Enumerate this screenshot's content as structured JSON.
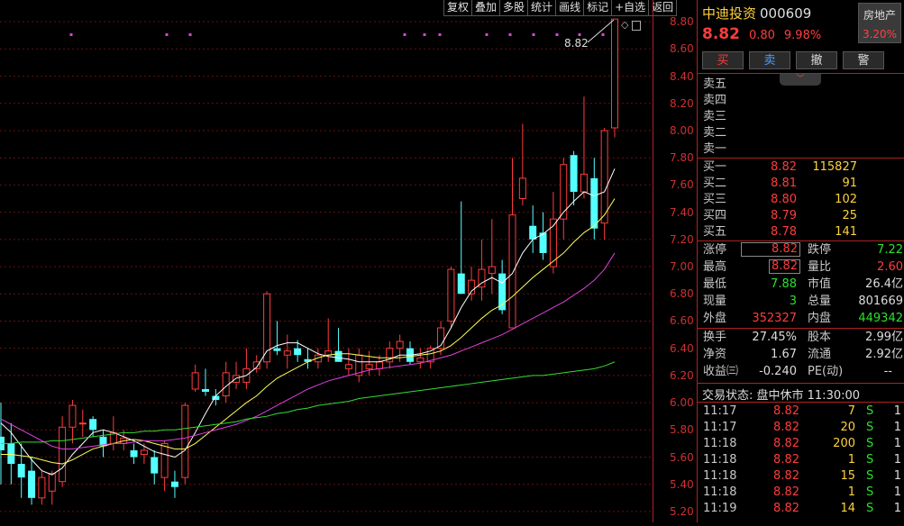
{
  "toolbar": [
    "复权",
    "叠加",
    "多股",
    "统计",
    "画线",
    "标记",
    "+自选",
    "返回"
  ],
  "chart_data": {
    "type": "candlestick",
    "y_axis_ticks": [
      "8.80",
      "8.60",
      "8.40",
      "8.20",
      "8.00",
      "7.80",
      "7.60",
      "7.40",
      "7.20",
      "7.00",
      "6.80",
      "6.60",
      "6.40",
      "6.20",
      "6.00",
      "5.80",
      "5.60",
      "5.40",
      "5.20"
    ],
    "ylim": [
      5.12,
      8.96
    ],
    "last_price_label": "8.82",
    "candles": [
      [
        5.75,
        6.0,
        5.4,
        5.65
      ],
      [
        5.7,
        5.85,
        5.4,
        5.55
      ],
      [
        5.55,
        5.7,
        5.3,
        5.45
      ],
      [
        5.5,
        5.6,
        5.25,
        5.3
      ],
      [
        5.3,
        5.5,
        5.25,
        5.45
      ],
      [
        5.35,
        5.5,
        5.25,
        5.48
      ],
      [
        5.42,
        5.9,
        5.38,
        5.82
      ],
      [
        5.82,
        6.02,
        5.7,
        5.98
      ],
      [
        5.85,
        5.95,
        5.75,
        5.85
      ],
      [
        5.88,
        5.9,
        5.75,
        5.8
      ],
      [
        5.75,
        5.8,
        5.6,
        5.68
      ],
      [
        5.7,
        5.9,
        5.65,
        5.78
      ],
      [
        5.7,
        5.8,
        5.65,
        5.74
      ],
      [
        5.65,
        5.7,
        5.55,
        5.6
      ],
      [
        5.62,
        5.7,
        5.55,
        5.65
      ],
      [
        5.6,
        5.65,
        5.4,
        5.48
      ],
      [
        5.45,
        5.72,
        5.35,
        5.7
      ],
      [
        5.42,
        5.5,
        5.3,
        5.38
      ],
      [
        5.45,
        6.0,
        5.4,
        5.98
      ],
      [
        6.1,
        6.28,
        6.08,
        6.22
      ],
      [
        6.1,
        6.25,
        6.05,
        6.08
      ],
      [
        6.05,
        6.1,
        5.98,
        6.02
      ],
      [
        6.05,
        6.3,
        6.0,
        6.22
      ],
      [
        6.15,
        6.3,
        6.1,
        6.2
      ],
      [
        6.15,
        6.4,
        6.1,
        6.25
      ],
      [
        6.25,
        6.35,
        6.22,
        6.3
      ],
      [
        6.3,
        6.82,
        6.25,
        6.8
      ],
      [
        6.4,
        6.6,
        6.35,
        6.38
      ],
      [
        6.35,
        6.5,
        6.25,
        6.38
      ],
      [
        6.4,
        6.46,
        6.3,
        6.35
      ],
      [
        6.32,
        6.4,
        6.25,
        6.3
      ],
      [
        6.3,
        6.4,
        6.25,
        6.35
      ],
      [
        6.35,
        6.62,
        6.3,
        6.38
      ],
      [
        6.38,
        6.55,
        6.35,
        6.3
      ],
      [
        6.25,
        6.4,
        6.2,
        6.28
      ],
      [
        6.2,
        6.4,
        6.15,
        6.35
      ],
      [
        6.25,
        6.38,
        6.2,
        6.28
      ],
      [
        6.25,
        6.35,
        6.2,
        6.3
      ],
      [
        6.3,
        6.45,
        6.25,
        6.4
      ],
      [
        6.4,
        6.5,
        6.3,
        6.45
      ],
      [
        6.4,
        6.45,
        6.28,
        6.3
      ],
      [
        6.3,
        6.4,
        6.25,
        6.33
      ],
      [
        6.3,
        6.42,
        6.25,
        6.4
      ],
      [
        6.4,
        6.6,
        6.35,
        6.55
      ],
      [
        6.6,
        7.0,
        6.55,
        6.98
      ],
      [
        6.95,
        7.48,
        6.8,
        6.8
      ],
      [
        6.8,
        7.0,
        6.75,
        6.9
      ],
      [
        6.85,
        7.2,
        6.75,
        6.98
      ],
      [
        6.95,
        7.35,
        6.8,
        7.0
      ],
      [
        6.95,
        7.05,
        6.65,
        6.68
      ],
      [
        6.55,
        7.8,
        6.55,
        7.38
      ],
      [
        7.5,
        8.05,
        7.45,
        7.65
      ],
      [
        7.3,
        7.45,
        7.1,
        7.2
      ],
      [
        7.25,
        7.4,
        7.05,
        7.1
      ],
      [
        7.0,
        7.55,
        6.95,
        7.35
      ],
      [
        7.35,
        7.8,
        7.2,
        7.75
      ],
      [
        7.82,
        7.85,
        7.45,
        7.55
      ],
      [
        7.55,
        8.25,
        7.5,
        7.68
      ],
      [
        7.65,
        7.8,
        7.2,
        7.28
      ],
      [
        7.32,
        8.02,
        7.2,
        8.0
      ],
      [
        8.02,
        8.82,
        7.95,
        8.82
      ]
    ],
    "ma_series": [
      {
        "color": "#ffffff",
        "values": [
          5.85,
          5.78,
          5.68,
          5.58,
          5.5,
          5.47,
          5.52,
          5.62,
          5.7,
          5.78,
          5.8,
          5.78,
          5.75,
          5.72,
          5.68,
          5.64,
          5.62,
          5.6,
          5.65,
          5.78,
          5.92,
          6.05,
          6.12,
          6.18,
          6.2,
          6.26,
          6.38,
          6.42,
          6.44,
          6.44,
          6.4,
          6.36,
          6.34,
          6.33,
          6.32,
          6.3,
          6.3,
          6.3,
          6.32,
          6.35,
          6.35,
          6.36,
          6.38,
          6.42,
          6.55,
          6.7,
          6.82,
          6.88,
          6.92,
          6.88,
          6.95,
          7.1,
          7.2,
          7.24,
          7.3,
          7.4,
          7.48,
          7.55,
          7.52,
          7.55,
          7.72
        ]
      },
      {
        "color": "#ffff55",
        "values": [
          5.62,
          5.62,
          5.61,
          5.6,
          5.58,
          5.56,
          5.55,
          5.58,
          5.62,
          5.66,
          5.68,
          5.7,
          5.72,
          5.73,
          5.72,
          5.7,
          5.68,
          5.66,
          5.66,
          5.7,
          5.76,
          5.82,
          5.88,
          5.94,
          6.0,
          6.05,
          6.12,
          6.18,
          6.22,
          6.26,
          6.3,
          6.33,
          6.35,
          6.36,
          6.36,
          6.35,
          6.34,
          6.33,
          6.33,
          6.33,
          6.34,
          6.35,
          6.36,
          6.38,
          6.42,
          6.48,
          6.55,
          6.62,
          6.68,
          6.72,
          6.78,
          6.85,
          6.92,
          6.98,
          7.04,
          7.1,
          7.18,
          7.25,
          7.3,
          7.38,
          7.5
        ]
      },
      {
        "color": "#e040e0",
        "values": [
          5.88,
          5.84,
          5.8,
          5.76,
          5.72,
          5.68,
          5.66,
          5.66,
          5.67,
          5.68,
          5.69,
          5.7,
          5.7,
          5.71,
          5.72,
          5.72,
          5.72,
          5.73,
          5.74,
          5.76,
          5.78,
          5.8,
          5.82,
          5.84,
          5.87,
          5.9,
          5.94,
          5.98,
          6.02,
          6.06,
          6.1,
          6.13,
          6.16,
          6.18,
          6.2,
          6.22,
          6.24,
          6.25,
          6.26,
          6.27,
          6.28,
          6.29,
          6.31,
          6.33,
          6.35,
          6.38,
          6.41,
          6.44,
          6.47,
          6.5,
          6.54,
          6.58,
          6.62,
          6.66,
          6.7,
          6.74,
          6.79,
          6.84,
          6.9,
          6.98,
          7.1
        ]
      },
      {
        "color": "#33dd33",
        "values": [
          5.7,
          5.7,
          5.71,
          5.71,
          5.71,
          5.72,
          5.72,
          5.73,
          5.74,
          5.75,
          5.76,
          5.77,
          5.78,
          5.78,
          5.79,
          5.79,
          5.8,
          5.8,
          5.81,
          5.82,
          5.83,
          5.84,
          5.85,
          5.86,
          5.88,
          5.89,
          5.9,
          5.92,
          5.93,
          5.95,
          5.96,
          5.98,
          5.99,
          6.0,
          6.01,
          6.03,
          6.04,
          6.05,
          6.06,
          6.07,
          6.08,
          6.09,
          6.1,
          6.11,
          6.12,
          6.13,
          6.14,
          6.15,
          6.16,
          6.17,
          6.18,
          6.19,
          6.2,
          6.2,
          6.21,
          6.22,
          6.23,
          6.24,
          6.25,
          6.27,
          6.3
        ]
      }
    ]
  },
  "panel": {
    "stock_name": "中迪投资",
    "stock_code": "000609",
    "sector": "房地产",
    "sector_change": "3.20%",
    "price": "8.82",
    "change": "0.80",
    "change_pct": "9.98%",
    "trade_buttons": [
      "买",
      "卖",
      "撤",
      "警"
    ],
    "asks": [
      "卖五",
      "卖四",
      "卖三",
      "卖二",
      "卖一"
    ],
    "bids": [
      {
        "label": "买一",
        "price": "8.82",
        "volume": "115827"
      },
      {
        "label": "买二",
        "price": "8.81",
        "volume": "91"
      },
      {
        "label": "买三",
        "price": "8.80",
        "volume": "102"
      },
      {
        "label": "买四",
        "price": "8.79",
        "volume": "25"
      },
      {
        "label": "买五",
        "price": "8.78",
        "volume": "141"
      }
    ],
    "stats": {
      "limit_up_label": "涨停",
      "limit_up": "8.82",
      "limit_down_label": "跌停",
      "limit_down": "7.22",
      "high_label": "最高",
      "high": "8.82",
      "vol_ratio_label": "量比",
      "vol_ratio": "2.60",
      "low_label": "最低",
      "low": "7.88",
      "market_cap_label": "市值",
      "market_cap": "26.4亿",
      "current_vol_label": "现量",
      "current_vol": "3",
      "total_vol_label": "总量",
      "total_vol": "801669",
      "outer_label": "外盘",
      "outer": "352327",
      "inner_label": "内盘",
      "inner": "449342",
      "turnover_label": "换手",
      "turnover": "27.45%",
      "equity_label": "股本",
      "equity": "2.99亿",
      "nav_label": "净资",
      "nav": "1.67",
      "float_label": "流通",
      "float": "2.92亿",
      "eps_label": "收益㈢",
      "eps": "-0.240",
      "pe_label": "PE(动)",
      "pe": "--"
    },
    "trade_status": "交易状态: 盘中休市 11:30:00",
    "ticks": [
      {
        "time": "11:17",
        "price": "8.82",
        "vol": "7",
        "side": "S",
        "n": "1"
      },
      {
        "time": "11:17",
        "price": "8.82",
        "vol": "20",
        "side": "S",
        "n": "1"
      },
      {
        "time": "11:18",
        "price": "8.82",
        "vol": "200",
        "side": "S",
        "n": "1"
      },
      {
        "time": "11:18",
        "price": "8.82",
        "vol": "1",
        "side": "S",
        "n": "1"
      },
      {
        "time": "11:18",
        "price": "8.82",
        "vol": "15",
        "side": "S",
        "n": "1"
      },
      {
        "time": "11:18",
        "price": "8.82",
        "vol": "1",
        "side": "S",
        "n": "1"
      },
      {
        "time": "11:19",
        "price": "8.82",
        "vol": "14",
        "side": "S",
        "n": "1"
      }
    ]
  }
}
